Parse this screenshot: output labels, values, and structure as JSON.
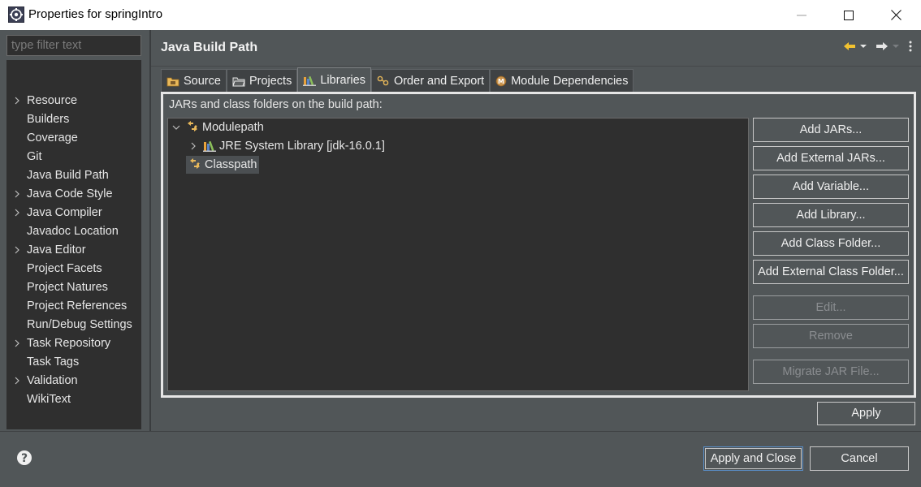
{
  "window": {
    "title": "Properties for springIntro",
    "minimize_icon": "minimize-icon",
    "maximize_icon": "maximize-icon",
    "close_icon": "close-icon"
  },
  "filter": {
    "placeholder": "type filter text"
  },
  "nav": {
    "items": [
      {
        "label": "Resource",
        "expandable": true
      },
      {
        "label": "Builders",
        "expandable": false
      },
      {
        "label": "Coverage",
        "expandable": false
      },
      {
        "label": "Git",
        "expandable": false
      },
      {
        "label": "Java Build Path",
        "expandable": false
      },
      {
        "label": "Java Code Style",
        "expandable": true
      },
      {
        "label": "Java Compiler",
        "expandable": true
      },
      {
        "label": "Javadoc Location",
        "expandable": false
      },
      {
        "label": "Java Editor",
        "expandable": true
      },
      {
        "label": "Project Facets",
        "expandable": false
      },
      {
        "label": "Project Natures",
        "expandable": false
      },
      {
        "label": "Project References",
        "expandable": false
      },
      {
        "label": "Run/Debug Settings",
        "expandable": false
      },
      {
        "label": "Task Repository",
        "expandable": true
      },
      {
        "label": "Task Tags",
        "expandable": false
      },
      {
        "label": "Validation",
        "expandable": true
      },
      {
        "label": "WikiText",
        "expandable": false
      }
    ]
  },
  "page": {
    "title": "Java Build Path"
  },
  "tabs": [
    {
      "label": "Source",
      "icon": "source-folder-icon"
    },
    {
      "label": "Projects",
      "icon": "projects-folder-icon"
    },
    {
      "label": "Libraries",
      "icon": "libraries-icon",
      "active": true
    },
    {
      "label": "Order and Export",
      "icon": "order-export-icon"
    },
    {
      "label": "Module Dependencies",
      "icon": "module-icon"
    }
  ],
  "libraries": {
    "label": "JARs and class folders on the build path:",
    "tree": {
      "modulepath": "Modulepath",
      "jre": "JRE System Library [jdk-16.0.1]",
      "classpath": "Classpath"
    },
    "buttons": {
      "add_jars": "Add JARs...",
      "add_external_jars": "Add External JARs...",
      "add_variable": "Add Variable...",
      "add_library": "Add Library...",
      "add_class_folder": "Add Class Folder...",
      "add_external_class_folder": "Add External Class Folder...",
      "edit": "Edit...",
      "remove": "Remove",
      "migrate_jar": "Migrate JAR File..."
    }
  },
  "apply": "Apply",
  "footer": {
    "apply_and_close": "Apply and Close",
    "cancel": "Cancel"
  },
  "colors": {
    "background": "#515658",
    "tree_background": "#2f2f2f",
    "focus_border": "#5a8fc9"
  }
}
